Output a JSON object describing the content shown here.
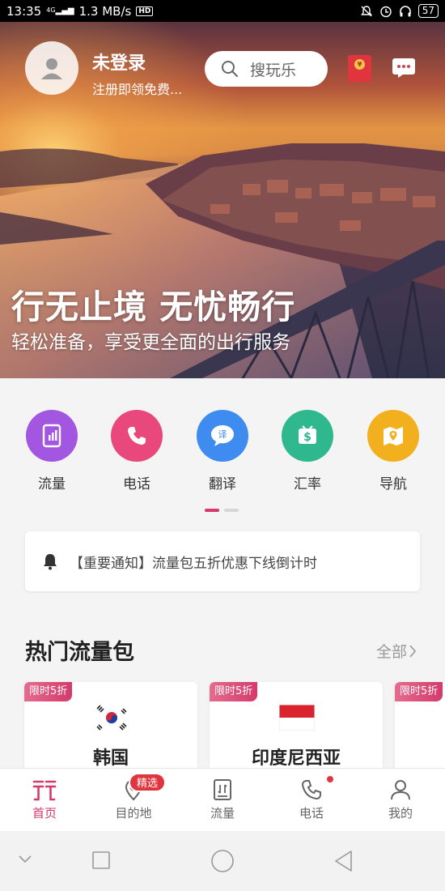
{
  "status_bar": {
    "time": "13:35",
    "network": "4G",
    "speed": "1.3 MB/s",
    "hd": "HD",
    "battery": "57"
  },
  "header": {
    "user_name": "未登录",
    "user_sub": "注册即领免费...",
    "search_placeholder": "搜玩乐",
    "red_packet_glyph": "¥"
  },
  "banner": {
    "title": "行无止境 无忧畅行",
    "subtitle": "轻松准备，享受更全面的出行服务"
  },
  "quick_menu": {
    "items": [
      {
        "label": "流量",
        "icon": "tablet-data-icon",
        "color": "#a356df"
      },
      {
        "label": "电话",
        "icon": "phone-icon",
        "color": "#e8487b"
      },
      {
        "label": "翻译",
        "icon": "translate-icon",
        "color": "#3f8cf0",
        "glyph": "译"
      },
      {
        "label": "汇率",
        "icon": "exchange-rate-icon",
        "color": "#2fb88d",
        "glyph": "$"
      },
      {
        "label": "导航",
        "icon": "map-navigation-icon",
        "color": "#f2b01e"
      }
    ],
    "page_count": 2,
    "active_page": 1
  },
  "notice": {
    "text": "【重要通知】流量包五折优惠下线倒计时"
  },
  "hot_packages": {
    "title": "热门流量包",
    "all_label": "全部",
    "cards": [
      {
        "tag": "限时5折",
        "country": "韩国",
        "flag": "korea-flag-icon"
      },
      {
        "tag": "限时5折",
        "country": "印度尼西亚",
        "flag": "indonesia-flag-icon"
      },
      {
        "tag": "限时5折",
        "country": "",
        "flag": ""
      }
    ]
  },
  "bottom_nav": {
    "items": [
      {
        "label": "首页",
        "icon": "home-icon",
        "active": true
      },
      {
        "label": "目的地",
        "icon": "location-pin-icon",
        "badge": "精选"
      },
      {
        "label": "流量",
        "icon": "data-book-icon"
      },
      {
        "label": "电话",
        "icon": "phone-icon",
        "dot": true
      },
      {
        "label": "我的",
        "icon": "user-icon"
      }
    ]
  },
  "colors": {
    "accent": "#d43a6b",
    "badge_red": "#e0343f"
  }
}
